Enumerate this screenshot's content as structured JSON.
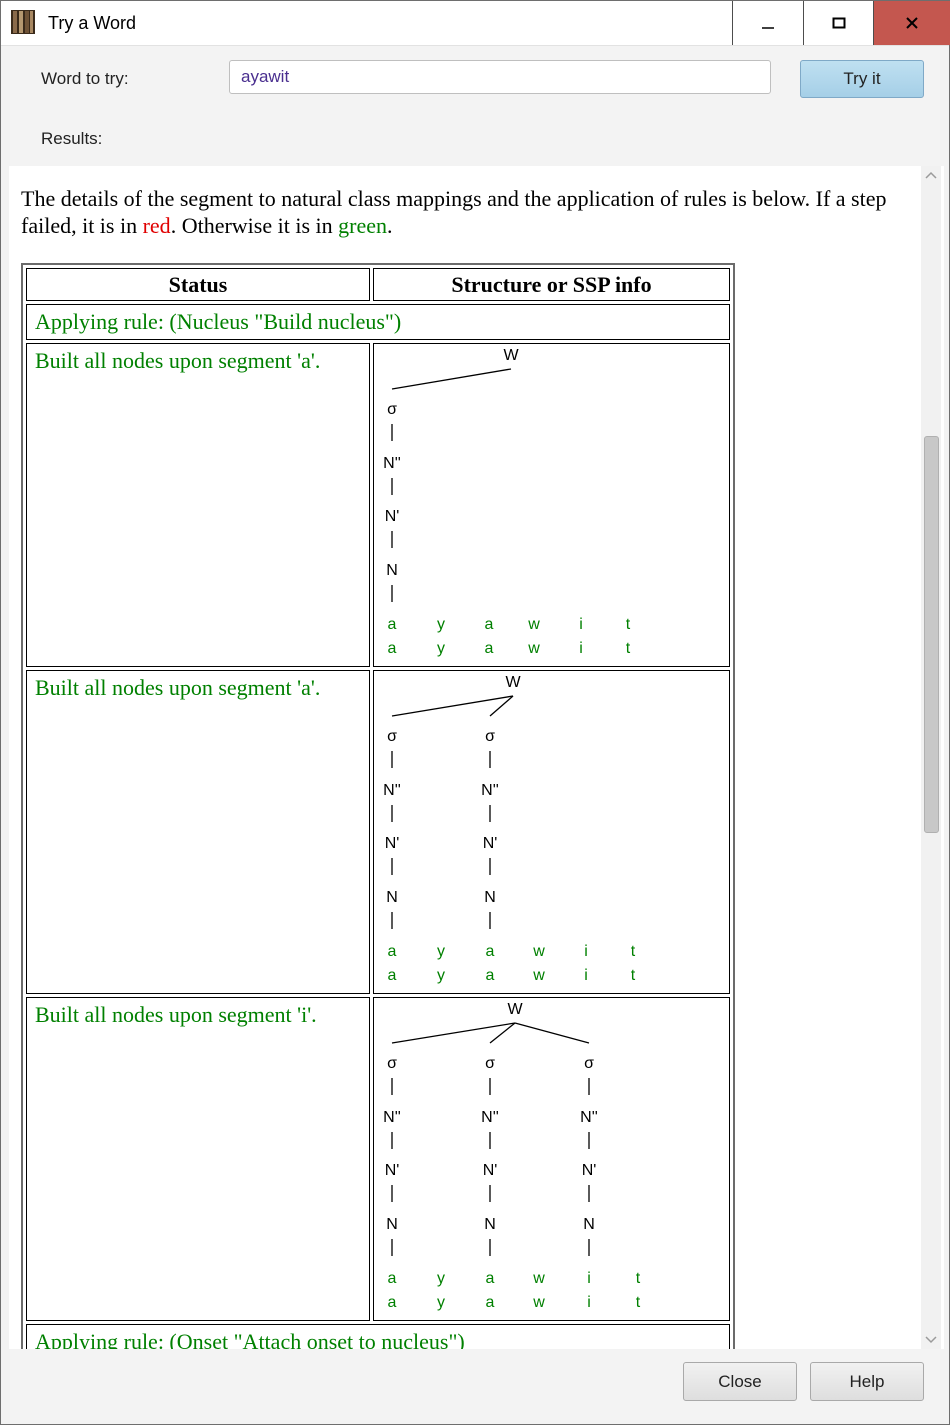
{
  "window": {
    "title": "Try a Word",
    "icon": "book-icon"
  },
  "form": {
    "word_label": "Word to try:",
    "word_value": "ayawit",
    "try_button": "Try it",
    "results_label": "Results:"
  },
  "intro": {
    "part1": "The details of the segment to natural class mappings and the application of rules is below. If a step failed, it is in ",
    "red_word": "red",
    "part2": ". Otherwise it is in ",
    "green_word": "green",
    "part3": "."
  },
  "table": {
    "headers": [
      "Status",
      "Structure or SSP info"
    ],
    "rule_row_1": "Applying rule: (Nucleus \"Build nucleus\")",
    "rows": [
      {
        "status": "Built all nodes upon segment 'a'.",
        "syllables": 1
      },
      {
        "status": "Built all nodes upon segment 'a'.",
        "syllables": 2
      },
      {
        "status": "Built all nodes upon segment 'i'.",
        "syllables": 3
      }
    ],
    "rule_row_2": "Applying rule: (Onset \"Attach onset to nucleus\")"
  },
  "tree": {
    "root": "W",
    "levels": [
      "σ",
      "N''",
      "N'",
      "N"
    ],
    "segments": [
      "a",
      "y",
      "a",
      "w",
      "i",
      "t"
    ],
    "nucleus_segments": [
      [
        0
      ],
      [
        0,
        2
      ],
      [
        0,
        2,
        4
      ]
    ]
  },
  "footer": {
    "close": "Close",
    "help": "Help"
  },
  "colors": {
    "green": "#008000",
    "red": "#e00000",
    "close_button": "#c4574f",
    "try_button": "#a5cfe7"
  }
}
